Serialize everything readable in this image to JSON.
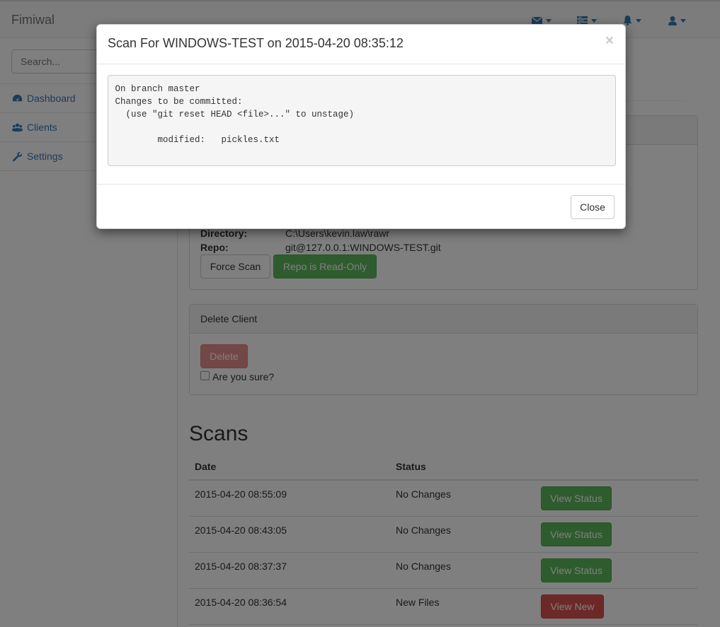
{
  "navbar": {
    "brand": "Fimiwal",
    "icons": [
      "envelope-icon",
      "tasks-icon",
      "bell-icon",
      "user-icon"
    ]
  },
  "sidebar": {
    "search_placeholder": "Search...",
    "items": [
      {
        "label": "Dashboard",
        "icon": "dashboard-icon"
      },
      {
        "label": "Clients",
        "icon": "users-icon"
      },
      {
        "label": "Settings",
        "icon": "wrench-icon"
      }
    ]
  },
  "client": {
    "directory_label": "Directory:",
    "directory_value": "C:\\Users\\kevin.law\\rawr",
    "repo_label": "Repo:",
    "repo_value": "git@127.0.0.1:WINDOWS-TEST.git",
    "force_scan_label": "Force Scan",
    "read_only_label": "Repo is Read-Only"
  },
  "delete_panel": {
    "heading": "Delete Client",
    "delete_label": "Delete",
    "confirm_label": "Are you sure?"
  },
  "scans": {
    "title": "Scans",
    "headers": {
      "date": "Date",
      "status": "Status"
    },
    "rows": [
      {
        "date": "2015-04-20 08:55:09",
        "status": "No Changes",
        "action": "View Status",
        "action_type": "success"
      },
      {
        "date": "2015-04-20 08:43:05",
        "status": "No Changes",
        "action": "View Status",
        "action_type": "success"
      },
      {
        "date": "2015-04-20 08:37:37",
        "status": "No Changes",
        "action": "View Status",
        "action_type": "success"
      },
      {
        "date": "2015-04-20 08:36:54",
        "status": "New Files",
        "action": "View New",
        "action_type": "danger"
      }
    ]
  },
  "modal": {
    "title": "Scan For WINDOWS-TEST on 2015-04-20 08:35:12",
    "close_x": "×",
    "output": "On branch master\nChanges to be committed:\n  (use \"git reset HEAD <file>...\" to unstage)\n\n        modified:   pickles.txt",
    "close_label": "Close"
  },
  "colors": {
    "primary": "#337ab7",
    "success": "#5cb85c",
    "danger": "#d9534f"
  }
}
